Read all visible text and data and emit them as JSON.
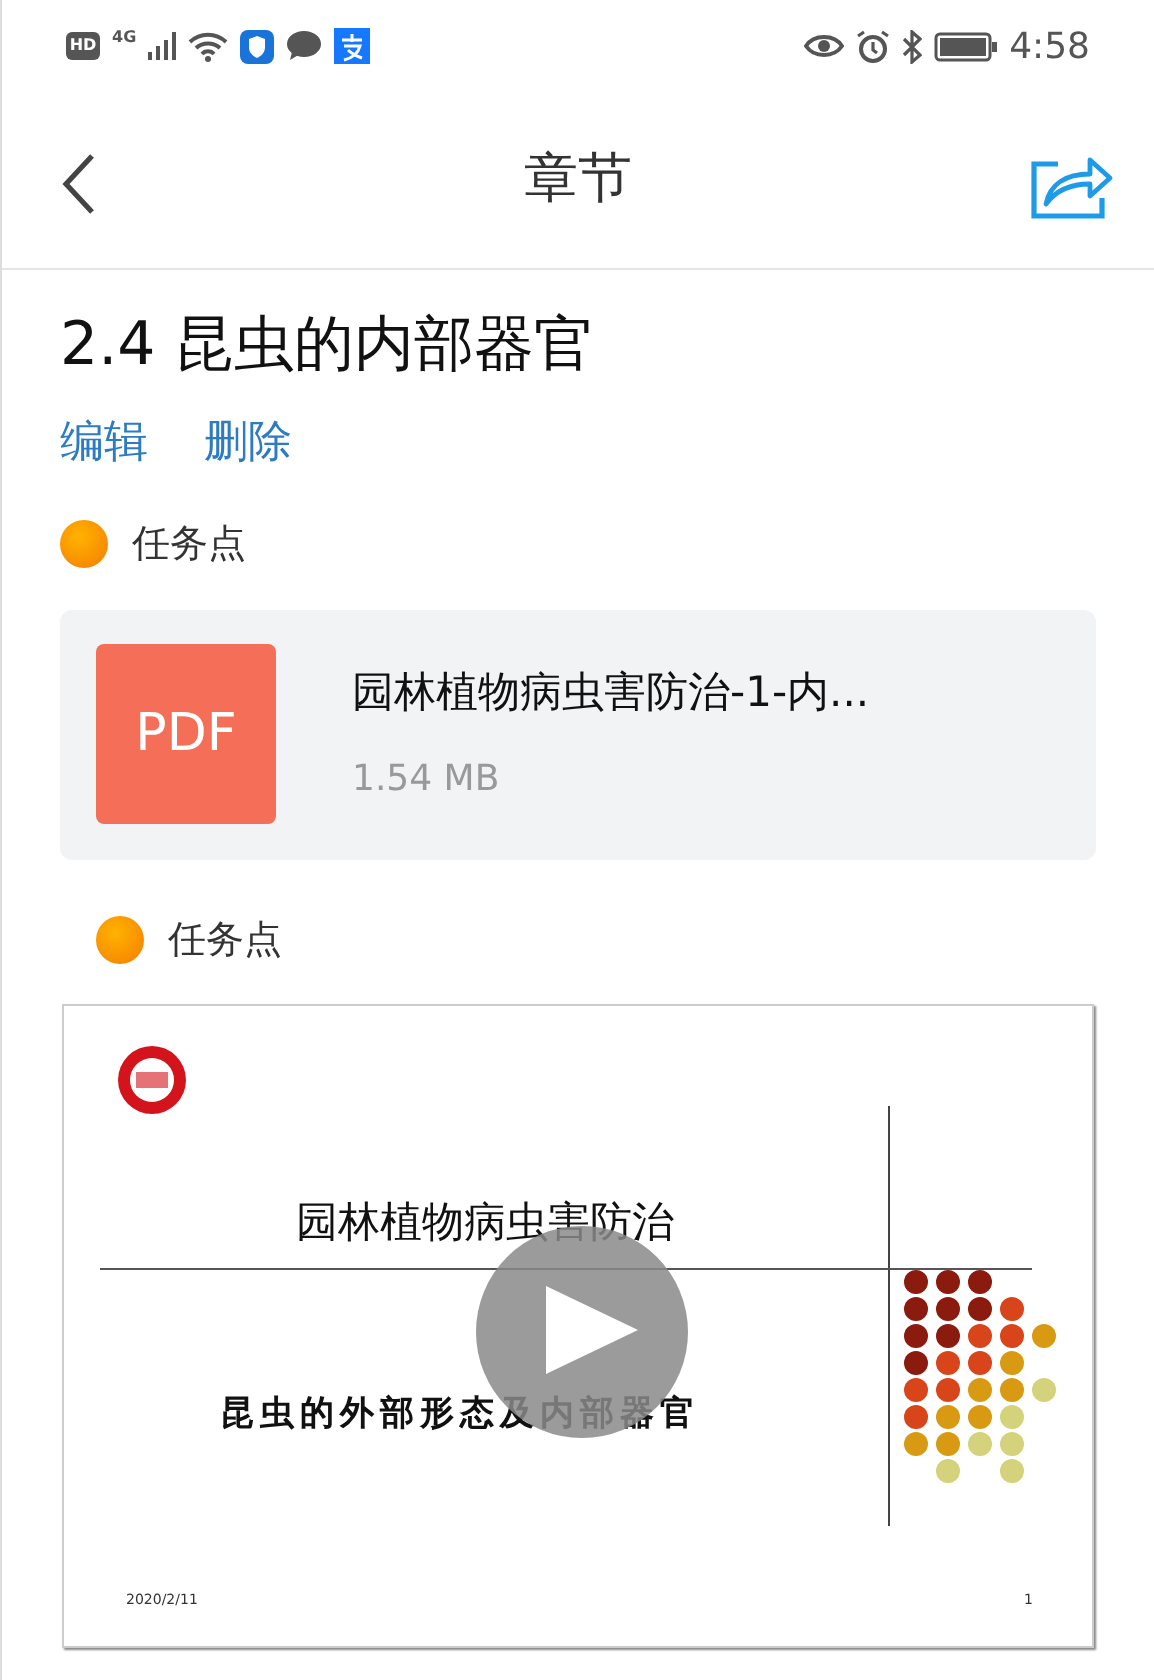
{
  "status_bar": {
    "hd": "HD",
    "network": "4G",
    "time": "4:58"
  },
  "header": {
    "title": "章节"
  },
  "chapter": {
    "title": "2.4 昆虫的内部器官",
    "actions": [
      "编辑",
      "删除"
    ]
  },
  "sections": [
    {
      "label": "任务点",
      "kind": "file",
      "file": {
        "type": "PDF",
        "name": "园林植物病虫害防治-1-内...",
        "size": "1.54 MB"
      }
    },
    {
      "label": "任务点",
      "kind": "slide",
      "slide": {
        "title": "园林植物病虫害防治",
        "subtitle": "昆虫的外部形态及内部器官",
        "date": "2020/2/11",
        "page": "1"
      }
    }
  ]
}
